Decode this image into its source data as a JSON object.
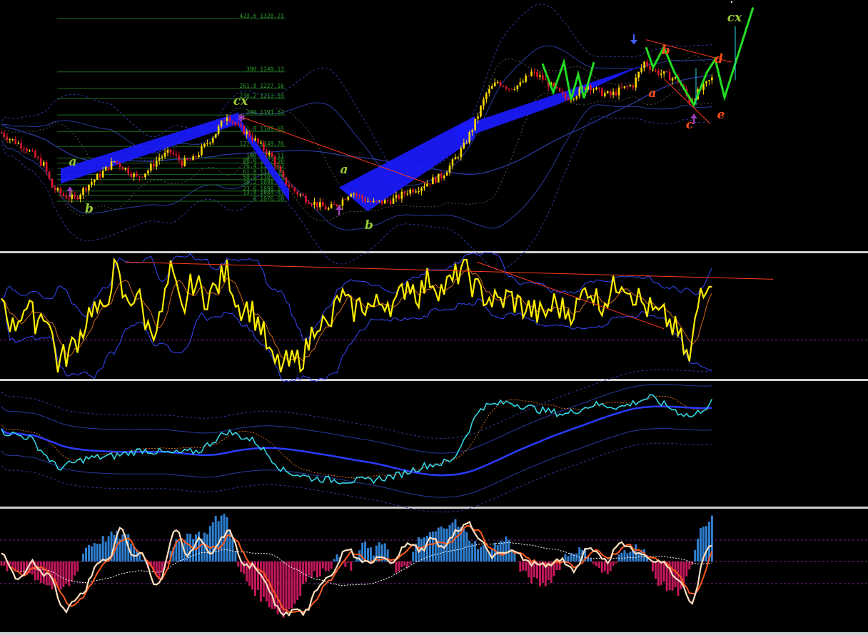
{
  "colors": {
    "background": "#000000",
    "separator": "#c8c8c8",
    "candle_up": "#ffd700",
    "candle_down": "#e0162b",
    "channel_fill": "#1a1aff",
    "bands": "#2a3aa0",
    "wave_green": "#9acd32",
    "wave_orange": "#ff4d1a",
    "pattern_line": "#22dd22",
    "fib_line": "#1e6e1e",
    "fib_text": "#2e9b2e",
    "osc_line": "#ffee00",
    "osc_signal": "#d2691e",
    "osc_band": "#3848ff",
    "trend_red": "#ff3b1a",
    "cyan_line": "#33d6e6",
    "hist_pos": "#2f7fd0",
    "hist_neg": "#c2185b",
    "fast_line": "#ffe0c0",
    "slow_line": "#ff5a1e",
    "dotted_white": "#ffffff",
    "grid_magenta": "#7a2a8a",
    "arrow_magenta": "#a040c0",
    "arrow_blue": "#4060ff"
  },
  "fib_levels": [
    {
      "label": "423.6 1320.21",
      "price": 1320.21
    },
    {
      "label": "300 1249.13",
      "price": 1249.13
    },
    {
      "label": "261.8 1227.16",
      "price": 1227.16
    },
    {
      "label": "238.2 1213.59",
      "price": 1213.59
    },
    {
      "label": "200 1191.62",
      "price": 1191.62
    },
    {
      "label": "161.8 1169.65",
      "price": 1169.65
    },
    {
      "label": "127.2 1149.76",
      "price": 1149.76
    },
    {
      "label": "100 1134.11",
      "price": 1134.11
    },
    {
      "label": "88.6 1127.56",
      "price": 1127.56
    },
    {
      "label": "76.4 1120.53",
      "price": 1120.53
    },
    {
      "label": "61.8 1112.14",
      "price": 1112.14
    },
    {
      "label": "50.0 1105.35",
      "price": 1105.35
    },
    {
      "label": "38.2 1098.56",
      "price": 1098.56
    },
    {
      "label": "23.6 1090.17",
      "price": 1090.17
    },
    {
      "label": "13.8 1084.53",
      "price": 1084.53
    },
    {
      "label": "0 1076.60",
      "price": 1076.6
    }
  ],
  "wave_labels": {
    "green": [
      "a",
      "b",
      "cx",
      "a",
      "b",
      "cx"
    ],
    "orange": [
      "b",
      "a",
      "c",
      "d",
      "e"
    ]
  },
  "chart_data": [
    {
      "type": "candlestick",
      "panel": "price",
      "waypoints": [
        [
          0,
          1168
        ],
        [
          3,
          1160
        ],
        [
          8,
          1150
        ],
        [
          12,
          1135
        ],
        [
          15,
          1125
        ],
        [
          18,
          1095
        ],
        [
          22,
          1084
        ],
        [
          26,
          1080
        ],
        [
          30,
          1096
        ],
        [
          35,
          1112
        ],
        [
          40,
          1130
        ],
        [
          44,
          1120
        ],
        [
          48,
          1108
        ],
        [
          52,
          1118
        ],
        [
          56,
          1135
        ],
        [
          60,
          1142
        ],
        [
          64,
          1128
        ],
        [
          68,
          1132
        ],
        [
          72,
          1150
        ],
        [
          76,
          1168
        ],
        [
          80,
          1192
        ],
        [
          84,
          1175
        ],
        [
          88,
          1165
        ],
        [
          92,
          1150
        ],
        [
          96,
          1135
        ],
        [
          100,
          1105
        ],
        [
          104,
          1090
        ],
        [
          108,
          1080
        ],
        [
          112,
          1072
        ],
        [
          116,
          1066
        ],
        [
          120,
          1075
        ],
        [
          124,
          1090
        ],
        [
          128,
          1080
        ],
        [
          132,
          1074
        ],
        [
          136,
          1076
        ],
        [
          140,
          1080
        ],
        [
          144,
          1090
        ],
        [
          148,
          1095
        ],
        [
          152,
          1103
        ],
        [
          156,
          1110
        ],
        [
          160,
          1128
        ],
        [
          164,
          1150
        ],
        [
          168,
          1182
        ],
        [
          172,
          1220
        ],
        [
          176,
          1236
        ],
        [
          180,
          1228
        ],
        [
          184,
          1232
        ],
        [
          188,
          1248
        ],
        [
          192,
          1240
        ],
        [
          196,
          1226
        ],
        [
          200,
          1214
        ],
        [
          204,
          1220
        ],
        [
          208,
          1232
        ],
        [
          212,
          1222
        ],
        [
          216,
          1218
        ],
        [
          220,
          1226
        ],
        [
          224,
          1232
        ],
        [
          228,
          1262
        ],
        [
          232,
          1250
        ],
        [
          236,
          1244
        ],
        [
          240,
          1238
        ],
        [
          244,
          1210
        ],
        [
          248,
          1225
        ],
        [
          252,
          1240
        ]
      ]
    },
    {
      "type": "line",
      "panel": "oscillator",
      "ylim": [
        0,
        100
      ],
      "waypoints": [
        [
          0,
          70
        ],
        [
          4,
          40
        ],
        [
          8,
          60
        ],
        [
          12,
          48
        ],
        [
          16,
          55
        ],
        [
          20,
          10
        ],
        [
          24,
          20
        ],
        [
          28,
          35
        ],
        [
          32,
          60
        ],
        [
          36,
          50
        ],
        [
          40,
          95
        ],
        [
          44,
          62
        ],
        [
          48,
          72
        ],
        [
          52,
          40
        ],
        [
          56,
          45
        ],
        [
          60,
          88
        ],
        [
          64,
          54
        ],
        [
          68,
          82
        ],
        [
          72,
          68
        ],
        [
          76,
          74
        ],
        [
          80,
          92
        ],
        [
          84,
          60
        ],
        [
          88,
          58
        ],
        [
          92,
          42
        ],
        [
          96,
          10
        ],
        [
          100,
          8
        ],
        [
          104,
          10
        ],
        [
          108,
          20
        ],
        [
          112,
          50
        ],
        [
          116,
          38
        ],
        [
          120,
          70
        ],
        [
          124,
          55
        ],
        [
          128,
          62
        ],
        [
          132,
          58
        ],
        [
          136,
          66
        ],
        [
          140,
          60
        ],
        [
          144,
          82
        ],
        [
          148,
          70
        ],
        [
          152,
          85
        ],
        [
          156,
          74
        ],
        [
          160,
          80
        ],
        [
          164,
          98
        ],
        [
          168,
          74
        ],
        [
          172,
          68
        ],
        [
          176,
          62
        ],
        [
          180,
          68
        ],
        [
          184,
          60
        ],
        [
          188,
          56
        ],
        [
          192,
          50
        ],
        [
          196,
          62
        ],
        [
          200,
          55
        ],
        [
          204,
          58
        ],
        [
          208,
          78
        ],
        [
          212,
          62
        ],
        [
          216,
          70
        ],
        [
          220,
          85
        ],
        [
          224,
          72
        ],
        [
          228,
          60
        ],
        [
          232,
          52
        ],
        [
          236,
          48
        ],
        [
          240,
          35
        ],
        [
          244,
          10
        ],
        [
          248,
          75
        ],
        [
          252,
          88
        ]
      ],
      "hline": 30
    },
    {
      "type": "line",
      "panel": "trend",
      "waypoints": [
        [
          0,
          60
        ],
        [
          10,
          55
        ],
        [
          20,
          30
        ],
        [
          30,
          38
        ],
        [
          40,
          40
        ],
        [
          50,
          45
        ],
        [
          60,
          42
        ],
        [
          70,
          44
        ],
        [
          80,
          60
        ],
        [
          90,
          52
        ],
        [
          100,
          28
        ],
        [
          110,
          22
        ],
        [
          120,
          20
        ],
        [
          130,
          20
        ],
        [
          140,
          24
        ],
        [
          150,
          32
        ],
        [
          160,
          36
        ],
        [
          170,
          80
        ],
        [
          180,
          84
        ],
        [
          190,
          78
        ],
        [
          200,
          74
        ],
        [
          210,
          82
        ],
        [
          220,
          80
        ],
        [
          230,
          88
        ],
        [
          240,
          76
        ],
        [
          245,
          72
        ],
        [
          252,
          84
        ]
      ]
    },
    {
      "type": "bar",
      "panel": "histogram",
      "hist": [
        [
          0,
          -2
        ],
        [
          10,
          -4
        ],
        [
          20,
          -10
        ],
        [
          25,
          -7
        ],
        [
          30,
          5
        ],
        [
          35,
          7
        ],
        [
          40,
          9
        ],
        [
          45,
          8
        ],
        [
          48,
          4
        ],
        [
          52,
          -1
        ],
        [
          56,
          -5
        ],
        [
          62,
          6
        ],
        [
          66,
          9
        ],
        [
          72,
          9
        ],
        [
          76,
          14
        ],
        [
          80,
          16
        ],
        [
          84,
          -2
        ],
        [
          88,
          -8
        ],
        [
          92,
          -12
        ],
        [
          96,
          -15
        ],
        [
          100,
          -18
        ],
        [
          104,
          -14
        ],
        [
          108,
          -6
        ],
        [
          112,
          -4
        ],
        [
          116,
          -2
        ],
        [
          120,
          2
        ],
        [
          124,
          -3
        ],
        [
          128,
          6
        ],
        [
          132,
          3
        ],
        [
          136,
          7
        ],
        [
          140,
          -4
        ],
        [
          144,
          -2
        ],
        [
          148,
          7
        ],
        [
          152,
          9
        ],
        [
          156,
          11
        ],
        [
          160,
          14
        ],
        [
          164,
          10
        ],
        [
          168,
          6
        ],
        [
          172,
          4
        ],
        [
          176,
          6
        ],
        [
          180,
          8
        ],
        [
          184,
          -3
        ],
        [
          188,
          -6
        ],
        [
          192,
          -8
        ],
        [
          196,
          -5
        ],
        [
          200,
          2
        ],
        [
          204,
          4
        ],
        [
          208,
          3
        ],
        [
          212,
          -3
        ],
        [
          216,
          -4
        ],
        [
          220,
          3
        ],
        [
          224,
          5
        ],
        [
          228,
          4
        ],
        [
          232,
          -6
        ],
        [
          236,
          -9
        ],
        [
          240,
          -10
        ],
        [
          244,
          -4
        ],
        [
          248,
          10
        ],
        [
          252,
          14
        ]
      ]
    }
  ]
}
